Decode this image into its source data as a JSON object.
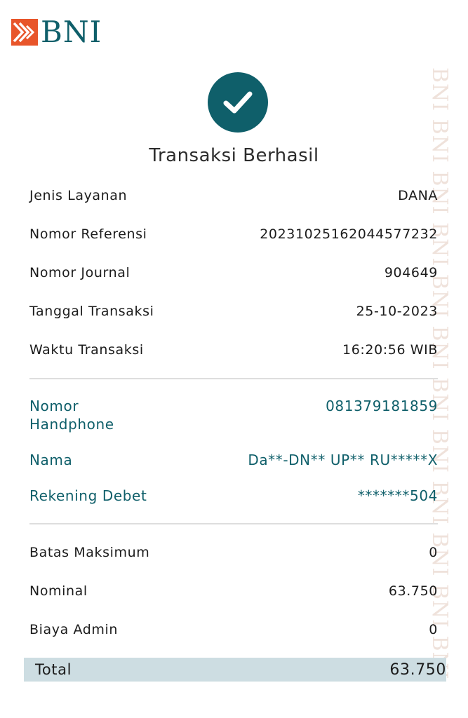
{
  "brand": {
    "name": "BNI",
    "watermark": "BNI BNI BNI BNI BNI BNI BNI BNI BNI BNI BNI BNI"
  },
  "status": {
    "icon": "check-circle-icon",
    "title": "Transaksi Berhasil"
  },
  "details": [
    {
      "label": "Jenis Layanan",
      "value": "DANA"
    },
    {
      "label": "Nomor Referensi",
      "value": "20231025162044577232"
    },
    {
      "label": "Nomor Journal",
      "value": "904649"
    },
    {
      "label": "Tanggal Transaksi",
      "value": "25-10-2023"
    },
    {
      "label": "Waktu Transaksi",
      "value": "16:20:56 WIB"
    }
  ],
  "account": [
    {
      "label": "Nomor\nHandphone",
      "value": "081379181859"
    },
    {
      "label": "Nama",
      "value": "Da**-DN** UP** RU*****X"
    },
    {
      "label": "Rekening Debet",
      "value": "*******504"
    }
  ],
  "amounts": [
    {
      "label": "Batas Maksimum",
      "value": "0"
    },
    {
      "label": "Nominal",
      "value": "63.750"
    },
    {
      "label": "Biaya Admin",
      "value": "0"
    }
  ],
  "total": {
    "label": "Total",
    "value": "63.750"
  },
  "colors": {
    "brand_teal": "#0f5f6a",
    "brand_orange": "#e8552a",
    "total_bg": "#cddde2"
  }
}
